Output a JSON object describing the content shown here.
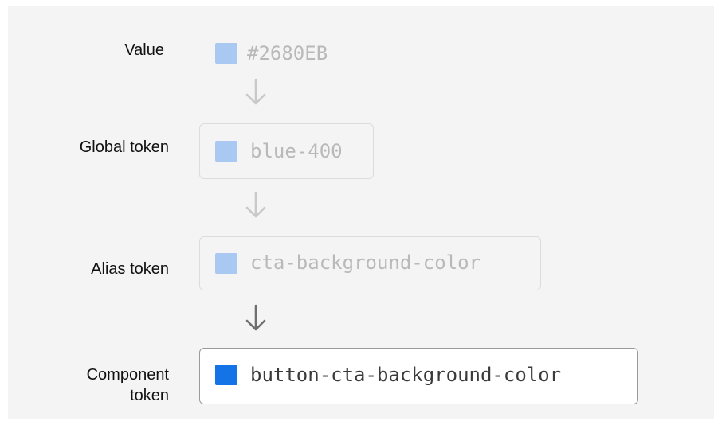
{
  "colors": {
    "faded_swatch": "#a9c9f2",
    "active_swatch": "#1473e6",
    "faded_arrow": "#c9c9c9",
    "active_arrow": "#6f6f6f"
  },
  "rows": [
    {
      "label": "Value",
      "token": "#2680EB",
      "state": "faded"
    },
    {
      "label": "Global token",
      "token": "blue-400",
      "state": "faded"
    },
    {
      "label": "Alias token",
      "token": "cta-background-color",
      "state": "faded"
    },
    {
      "label_line1": "Component",
      "label_line2": "token",
      "token": "button-cta-background-color",
      "state": "active"
    }
  ],
  "arrow_icon": "arrow-down-icon"
}
